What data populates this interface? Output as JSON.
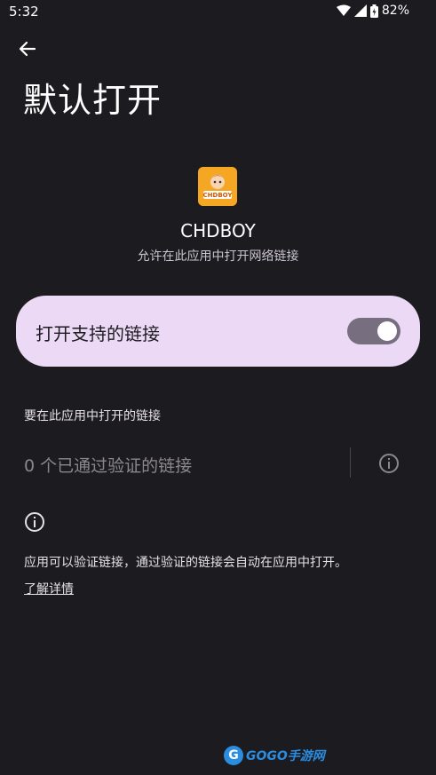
{
  "status_bar": {
    "time": "5:32",
    "battery": "82%"
  },
  "header": {
    "title": "默认打开"
  },
  "app": {
    "name": "CHDBOY",
    "description": "允许在此应用中打开网络链接",
    "icon_label": "CHDBOY"
  },
  "toggle": {
    "label": "打开支持的链接",
    "enabled": true
  },
  "links_section": {
    "header": "要在此应用中打开的链接",
    "verified_links": "0 个已通过验证的链接"
  },
  "info": {
    "text": "应用可以验证链接，通过验证的链接会自动在应用中打开。",
    "learn_more": "了解详情"
  },
  "watermark": {
    "text": "GOGO手游网"
  },
  "colors": {
    "background": "#1c1b1f",
    "card": "#ecd9f5",
    "switch_track": "#776f7f",
    "watermark": "#2a8de0"
  }
}
